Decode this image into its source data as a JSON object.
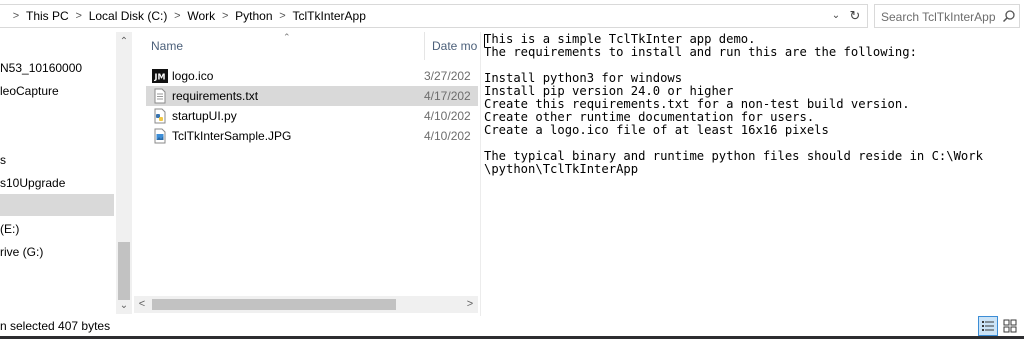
{
  "address_bar": {
    "crumbs": [
      "This PC",
      "Local Disk (C:)",
      "Work",
      "Python",
      "TclTkInterApp"
    ]
  },
  "search": {
    "placeholder": "Search TclTkInterApp"
  },
  "nav_pane": {
    "items": [
      "N53_10160000",
      "leoCapture",
      "s",
      "s10Upgrade",
      "",
      "(E:)",
      "rive (G:)"
    ],
    "selected_index": 4
  },
  "file_list": {
    "columns": {
      "name": "Name",
      "date": "Date mo"
    },
    "files": [
      {
        "name": "logo.ico",
        "date": "3/27/202",
        "icon": "jm-logo-icon"
      },
      {
        "name": "requirements.txt",
        "date": "4/17/202",
        "icon": "text-file-icon",
        "selected": true
      },
      {
        "name": "startupUI.py",
        "date": "4/10/202",
        "icon": "python-file-icon"
      },
      {
        "name": "TclTkInterSample.JPG",
        "date": "4/10/202",
        "icon": "image-file-icon"
      }
    ]
  },
  "preview": {
    "text": "This is a simple TclTkInter app demo.\nThe requirements to install and run this are the following:\n\nInstall python3 for windows\nInstall pip version 24.0 or higher\nCreate this requirements.txt for a non-test build version.\nCreate other runtime documentation for users.\nCreate a logo.ico file of at least 16x16 pixels\n\nThe typical binary and runtime python files should reside in C:\\Work\n\\python\\TclTkInterApp"
  },
  "status_bar": {
    "text": "n selected  407 bytes"
  },
  "colors": {
    "selection": "#d9d9d9",
    "header_text": "#4c607a",
    "accent": "#3c8dd6"
  }
}
